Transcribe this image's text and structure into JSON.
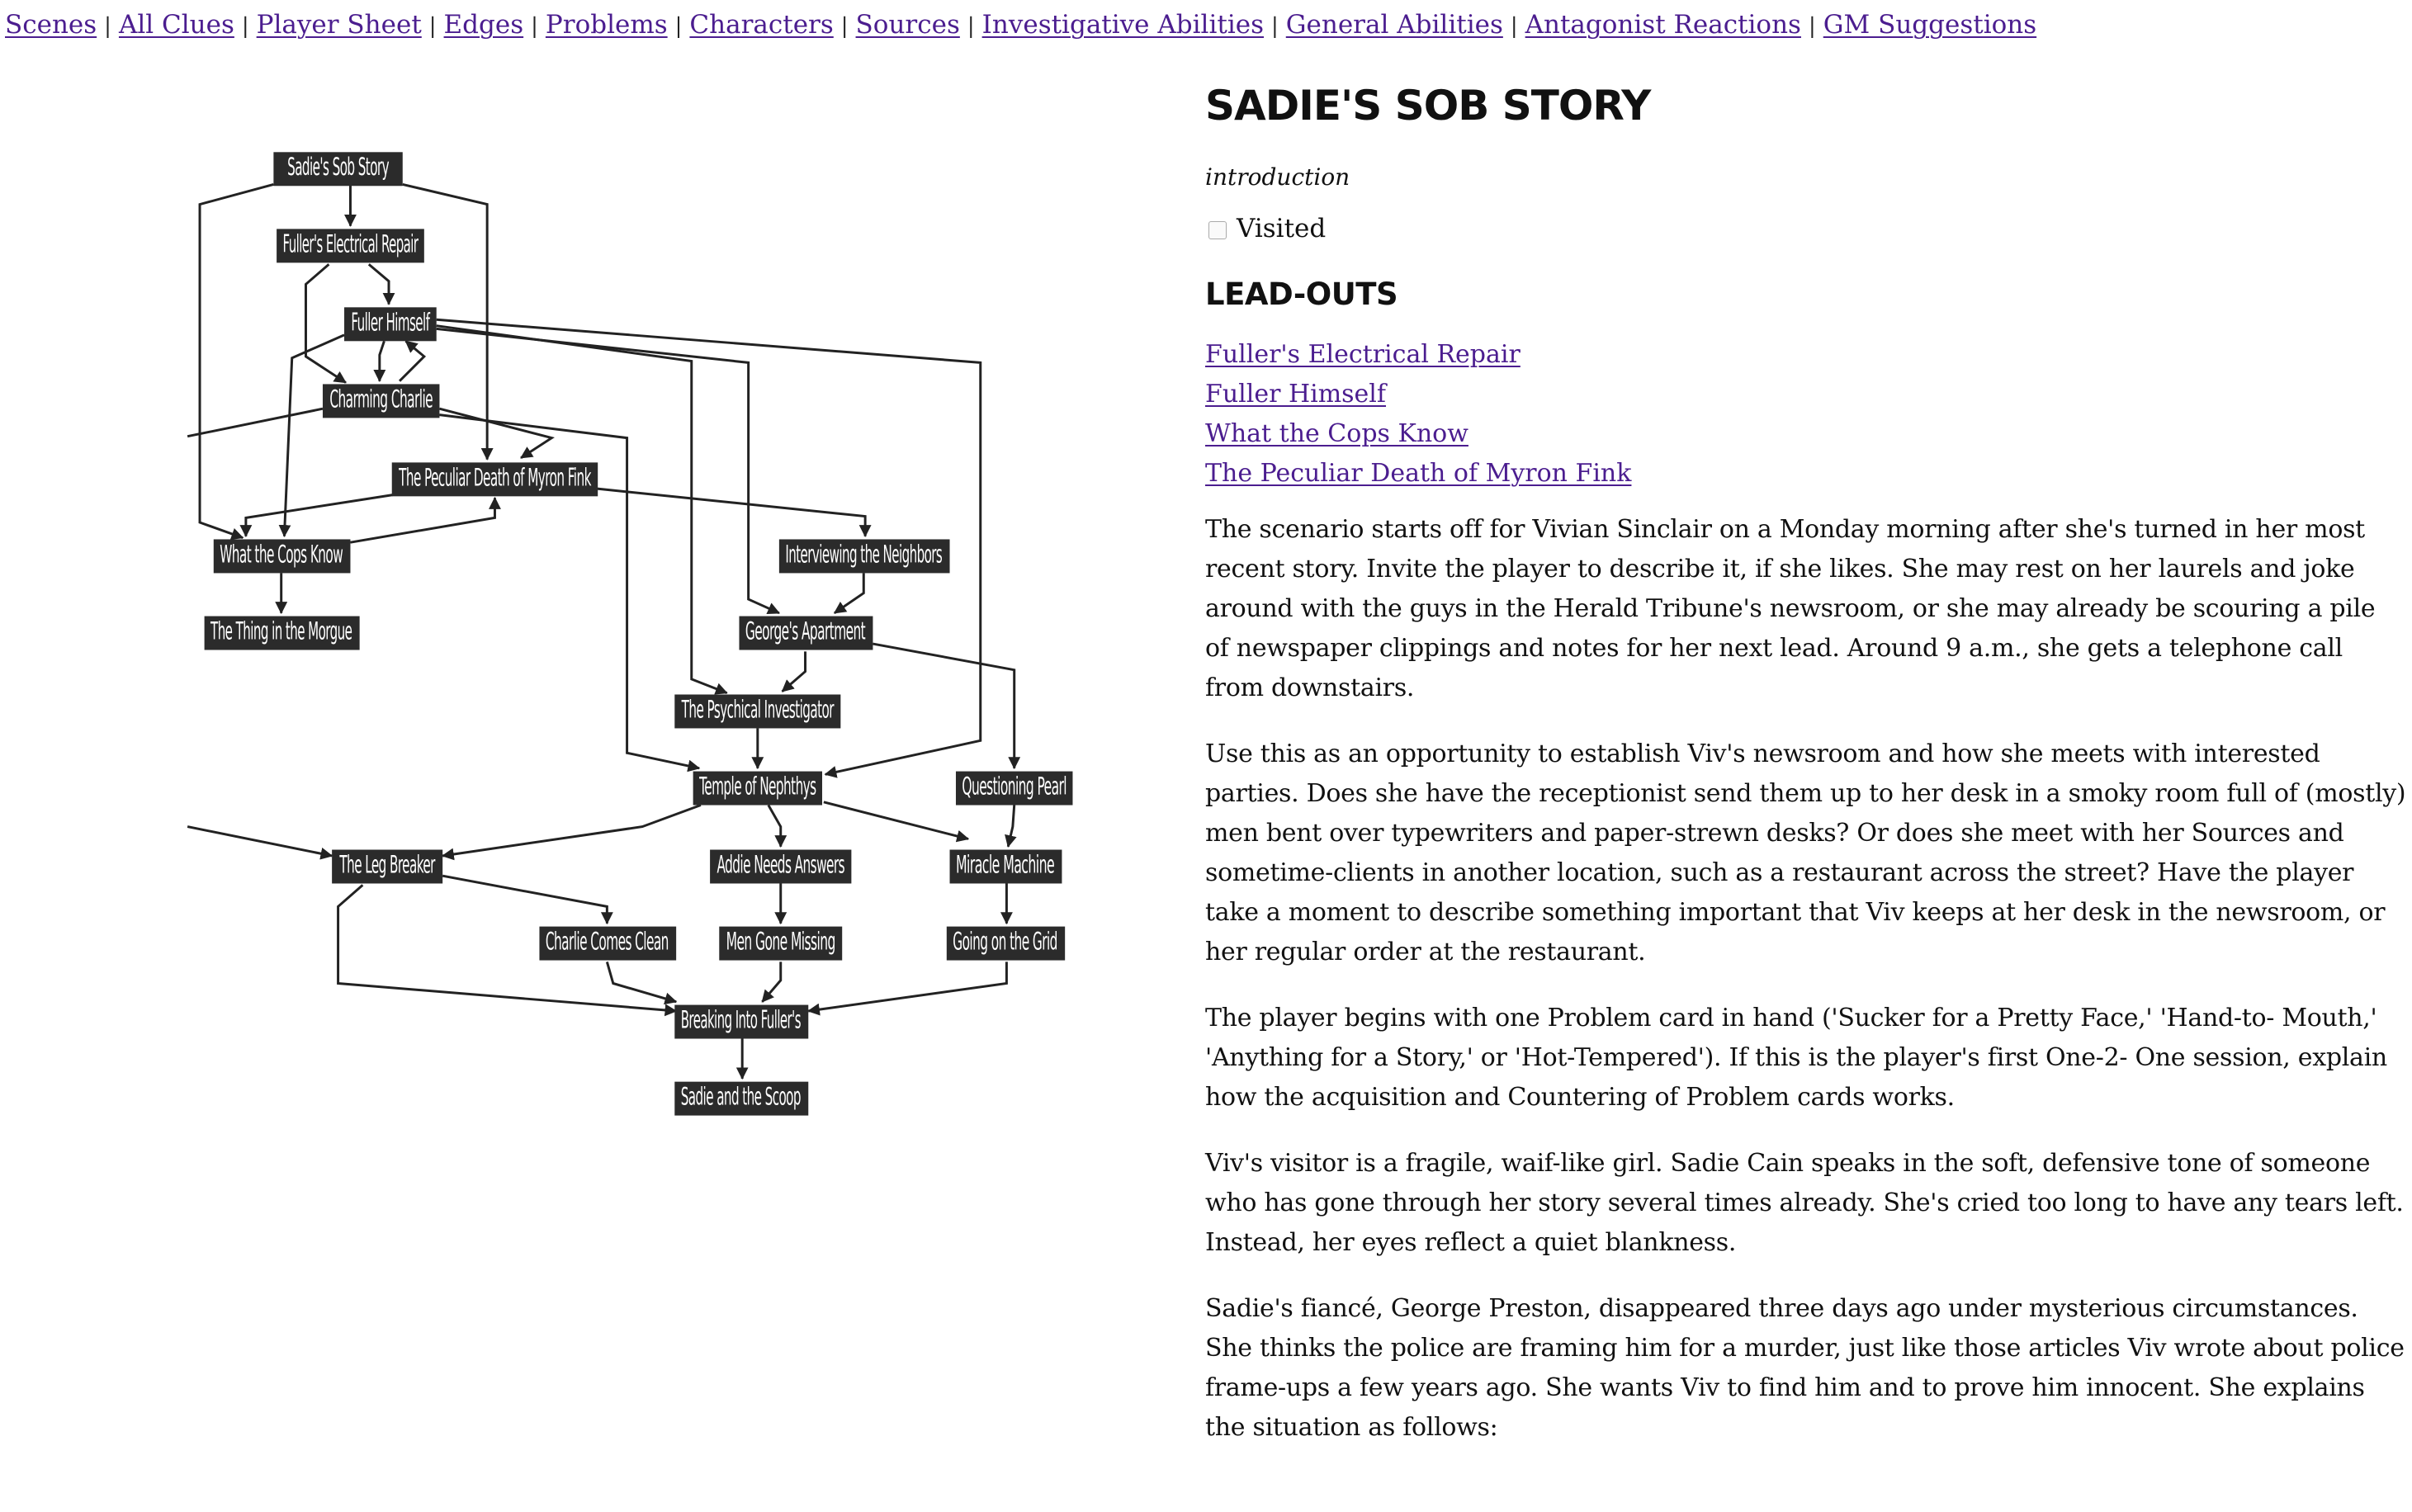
{
  "nav": {
    "links": [
      "Scenes",
      "All Clues",
      "Player Sheet",
      "Edges",
      "Problems",
      "Characters",
      "Sources",
      "Investigative Abilities",
      "General Abilities",
      "Antagonist Reactions",
      "GM Suggestions"
    ],
    "separator": "|"
  },
  "graph": {
    "nodes": [
      "Sadie's Sob Story",
      "Fuller's Electrical Repair",
      "Fuller Himself",
      "Charming Charlie",
      "The Peculiar Death of Myron Fink",
      "What the Cops Know",
      "Interviewing the Neighbors",
      "The Thing in the Morgue",
      "George's Apartment",
      "The Psychical Investigator",
      "Temple of Nephthys",
      "Questioning Pearl",
      "The Leg Breaker",
      "Addie Needs Answers",
      "Miracle Machine",
      "Charlie Comes Clean",
      "Men Gone Missing",
      "Going on the Grid",
      "Breaking Into Fuller's",
      "Sadie and the Scoop"
    ]
  },
  "scene": {
    "title": "SADIE'S SOB STORY",
    "type": "introduction",
    "visited_label": "Visited",
    "visited": false,
    "leadouts_heading": "LEAD-OUTS",
    "leadouts": [
      "Fuller's Electrical Repair",
      "Fuller Himself",
      "What the Cops Know",
      "The Peculiar Death of Myron Fink"
    ],
    "paragraphs": [
      "The scenario starts off for Vivian Sinclair on a Monday morning after she's turned in her most recent story. Invite the player to describe it, if she likes. She may rest on her laurels and joke around with the guys in the Herald Tribune's newsroom, or she may already be scouring a pile of newspaper clippings and notes for her next lead. Around 9 a.m., she gets a telephone call from downstairs.",
      "Use this as an opportunity to establish Viv's newsroom and how she meets with interested parties. Does she have the receptionist send them up to her desk in a smoky room full of (mostly) men bent over typewriters and paper-strewn desks? Or does she meet with her Sources and sometime-clients in another location, such as a restaurant across the street? Have the player take a moment to describe something important that Viv keeps at her desk in the newsroom, or her regular order at the restaurant.",
      "The player begins with one Problem card in hand ('Sucker for a Pretty Face,' 'Hand-to- Mouth,' 'Anything for a Story,' or 'Hot-Tempered'). If this is the player's first One-2- One session, explain how the acquisition and Countering of Problem cards works.",
      "Viv's visitor is a fragile, waif-like girl. Sadie Cain speaks in the soft, defensive tone of someone who has gone through her story several times already. She's cried too long to have any tears left. Instead, her eyes reflect a quiet blankness.",
      "Sadie's fiancé, George Preston, disappeared three days ago under mysterious circumstances. She thinks the police are framing him for a murder, just like those articles Viv wrote about police frame-ups a few years ago. She wants Viv to find him and to prove him innocent. She explains the situation as follows:"
    ]
  }
}
